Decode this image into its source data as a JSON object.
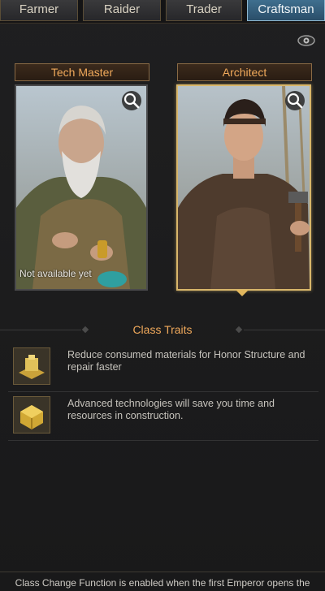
{
  "tabs": [
    {
      "label": "Farmer",
      "active": false
    },
    {
      "label": "Raider",
      "active": false
    },
    {
      "label": "Trader",
      "active": false
    },
    {
      "label": "Craftsman",
      "active": true
    }
  ],
  "cards": [
    {
      "title": "Tech Master",
      "status": "Not available yet",
      "selected": false,
      "icon": "magnifier-icon"
    },
    {
      "title": "Architect",
      "status": "",
      "selected": true,
      "icon": "magnifier-icon"
    }
  ],
  "traits": {
    "title": "Class Traits",
    "items": [
      {
        "icon": "gold-structure-icon",
        "text": "Reduce consumed materials for Honor Structure and repair faster"
      },
      {
        "icon": "gold-crate-icon",
        "text": "Advanced technologies will save you time and resources in construction."
      }
    ]
  },
  "footer": {
    "text": "Class Change Function is enabled when the first Emperor opens the"
  },
  "colors": {
    "accent_orange": "#f0a95b",
    "active_tab": "#3f6f8f",
    "selected_border": "#d8b66a"
  }
}
